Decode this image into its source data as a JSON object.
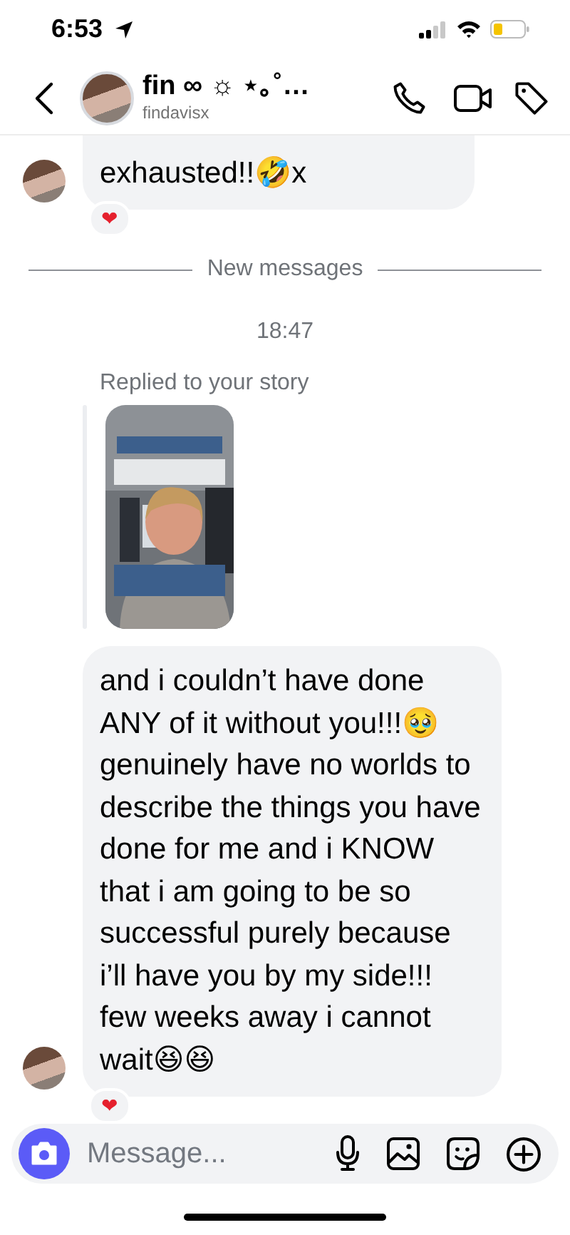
{
  "status_bar": {
    "time": "6:53"
  },
  "header": {
    "name": "fin ∞ ☼ ⋆｡˚…",
    "username": "findavisx"
  },
  "messages": [
    {
      "kind": "text",
      "text": "exhausted!!🤣x",
      "avatar": true,
      "reaction": "❤"
    },
    {
      "kind": "divider",
      "text": "New messages"
    },
    {
      "kind": "time",
      "text": "18:47"
    },
    {
      "kind": "story",
      "label": "Replied to your story"
    },
    {
      "kind": "text",
      "text": "and i couldn’t have done ANY of it without you!!!🥹 genuinely have no worlds to describe the things you have done for me and i KNOW that i am going to be so successful purely because i’ll have you by my side!!! few weeks away i cannot wait😆😆",
      "avatar": true,
      "reaction": "❤"
    }
  ],
  "composer": {
    "placeholder": "Message..."
  }
}
